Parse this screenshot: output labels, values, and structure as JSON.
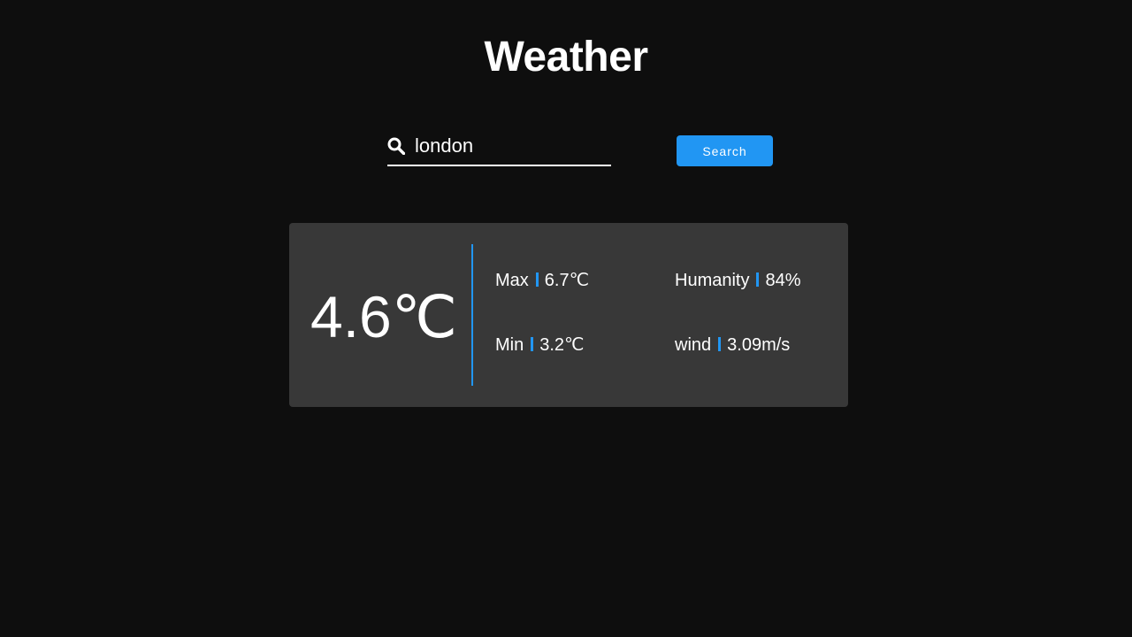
{
  "header": {
    "title": "Weather"
  },
  "search": {
    "icon": "search-icon",
    "value": "london",
    "button_label": "Search"
  },
  "weather": {
    "current_temp": "4.6",
    "temp_unit": "℃",
    "max": {
      "label": "Max",
      "value": "6.7",
      "unit": "℃"
    },
    "min": {
      "label": "Min",
      "value": "3.2",
      "unit": "℃"
    },
    "humidity": {
      "label": "Humanity",
      "value": "84%"
    },
    "wind": {
      "label": "wind",
      "value": "3.09m/s"
    }
  },
  "colors": {
    "background": "#0e0e0e",
    "card": "#383838",
    "accent": "#2196f3",
    "text": "#ffffff"
  }
}
